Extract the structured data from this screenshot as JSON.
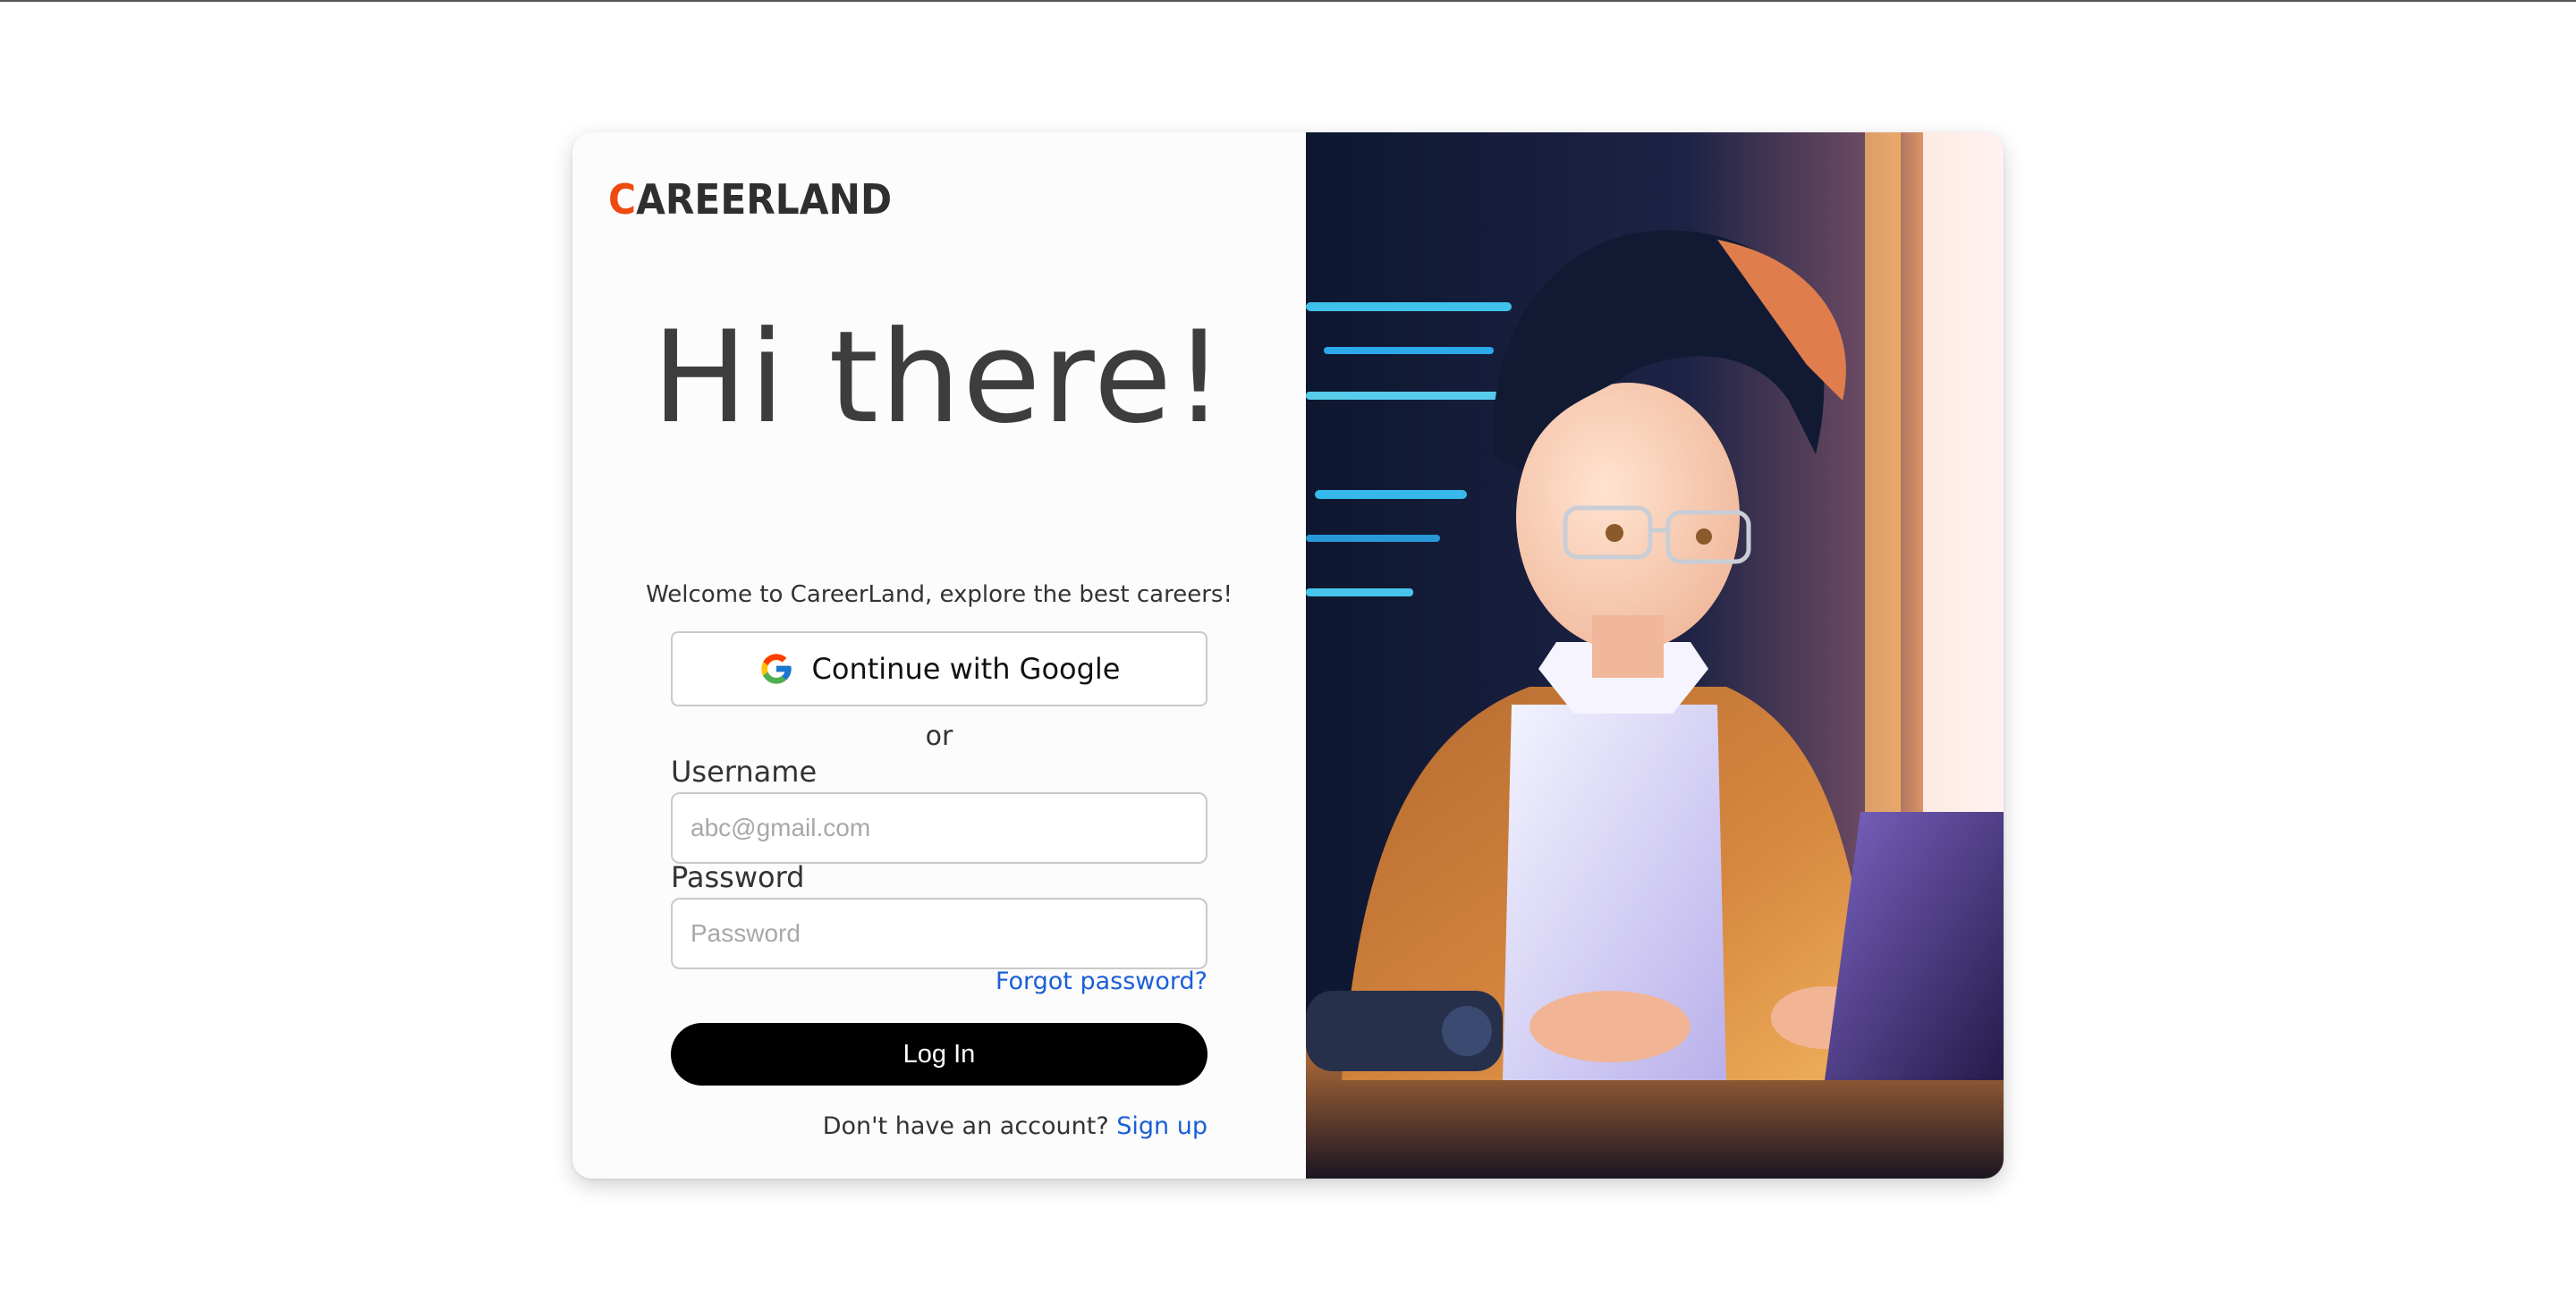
{
  "brand": {
    "logo_first_letter": "C",
    "logo_rest": "AREERLAND",
    "accent_color": "#ee4a10"
  },
  "hero": {
    "heading": "Hi there!",
    "subtitle": "Welcome to CareerLand, explore the best careers!"
  },
  "google_button": {
    "label": "Continue with Google",
    "icon": "google-g-icon"
  },
  "divider": {
    "text": "or"
  },
  "form": {
    "username_label": "Username",
    "username_placeholder": "abc@gmail.com",
    "password_label": "Password",
    "password_placeholder": "Password",
    "forgot_password": "Forgot password?",
    "login_button": "Log In"
  },
  "signup": {
    "prompt": "Don't have an account?",
    "link": "Sign up"
  },
  "illustration": {
    "description_icon": "anime-student-at-laptop-illustration"
  },
  "colors": {
    "link": "#1a5fd8",
    "login_button_bg": "#000000"
  }
}
